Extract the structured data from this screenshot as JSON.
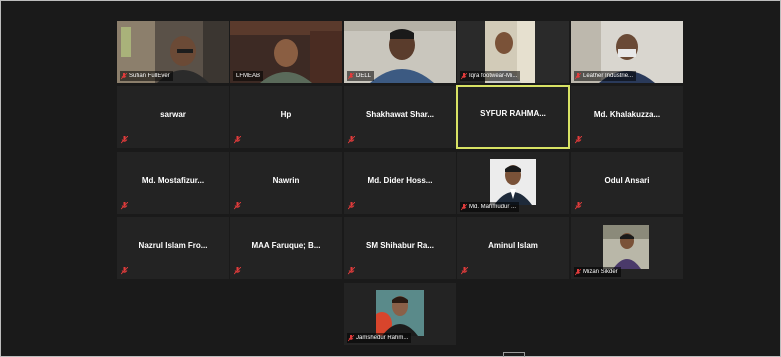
{
  "colors": {
    "background": "#1a1a1a",
    "tile": "#232323",
    "active_border": "#d8e264",
    "muted_mic": "#e03b3b"
  },
  "participants": [
    {
      "name": "Sufian FullEver",
      "type": "video"
    },
    {
      "name": "LFMEAB",
      "type": "video"
    },
    {
      "name": "DELL",
      "type": "video"
    },
    {
      "name": "Iqra footwear-Mi...",
      "type": "video"
    },
    {
      "name": "Leather Industrie...",
      "type": "video"
    },
    {
      "name": "sarwar",
      "type": "name"
    },
    {
      "name": "Hp",
      "type": "name"
    },
    {
      "name": "Shakhawat Shar...",
      "type": "name"
    },
    {
      "name": "SYFUR RAHMA...",
      "type": "name",
      "active": true
    },
    {
      "name": "Md. Khalakuzza...",
      "type": "name"
    },
    {
      "name": "Md. Mostafizur...",
      "type": "name"
    },
    {
      "name": "Nawrin",
      "type": "name"
    },
    {
      "name": "Md. Dider Hoss...",
      "type": "name"
    },
    {
      "name": "Md. Mahmudur ...",
      "type": "photo"
    },
    {
      "name": "Odul Ansari",
      "type": "name"
    },
    {
      "name": "Nazrul Islam Fro...",
      "type": "name"
    },
    {
      "name": "MAA Faruque; B...",
      "type": "name"
    },
    {
      "name": "SM Shihabur Ra...",
      "type": "name"
    },
    {
      "name": "Aminul Islam",
      "type": "name"
    },
    {
      "name": "Mizan Sikder",
      "type": "photo"
    },
    {
      "name": "Jamshedur Rahm...",
      "type": "photo"
    }
  ]
}
